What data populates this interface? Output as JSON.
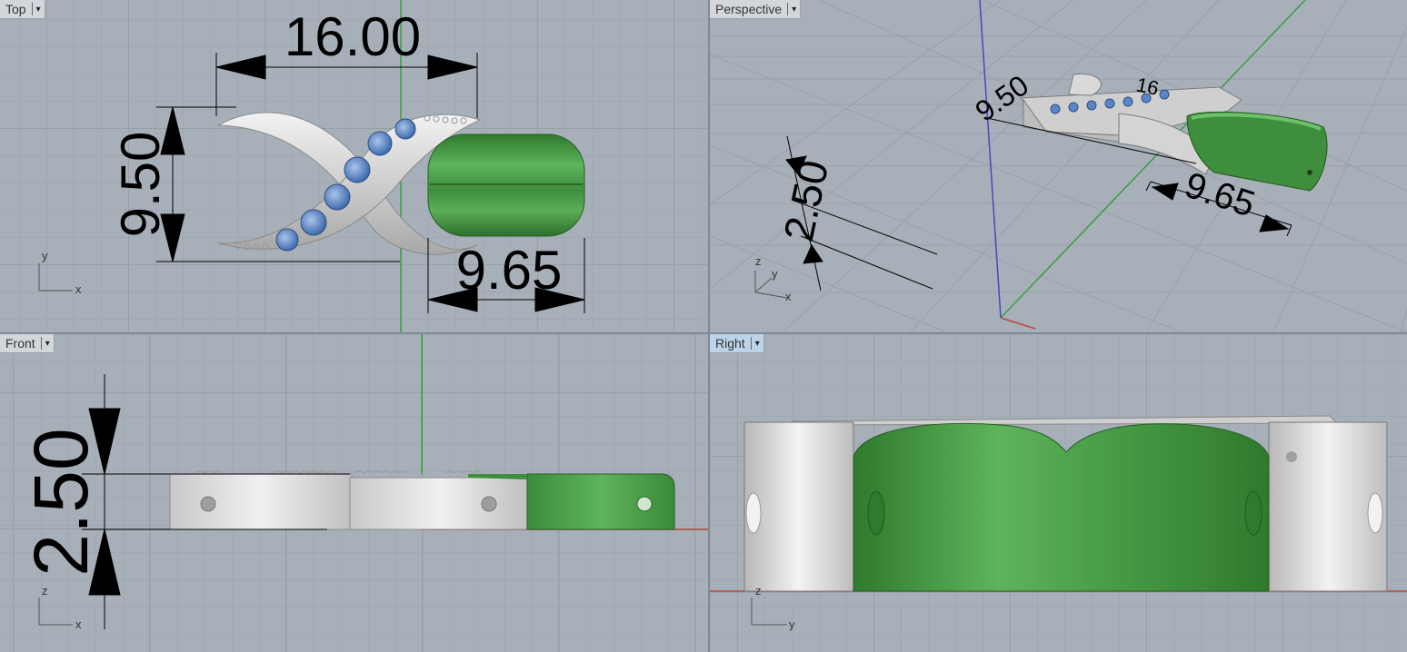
{
  "viewports": {
    "top": {
      "label": "Top",
      "dims": {
        "width": "16.00",
        "height": "9.50",
        "bead": "9.65"
      },
      "axes": {
        "v": "y",
        "h": "x"
      }
    },
    "perspective": {
      "label": "Perspective",
      "dims": {
        "thickness": "2.50",
        "height": "9.50",
        "width": "16",
        "bead": "9.65"
      },
      "axes": {
        "z": "z",
        "y": "y",
        "x": "x"
      }
    },
    "front": {
      "label": "Front",
      "dims": {
        "thickness": "2.50"
      },
      "axes": {
        "v": "z",
        "h": "x"
      }
    },
    "right": {
      "label": "Right",
      "axes": {
        "v": "z",
        "h": "y"
      }
    }
  },
  "icons": {
    "dropdown": "chevron-down-icon"
  },
  "colors": {
    "grid_bg": "#a7b0b9",
    "grid_line": "#98a1aa",
    "silver": "#d4d4d4",
    "green": "#4a9a48",
    "gem": "#5a86c8",
    "axis_x": "#b5473f",
    "axis_y": "#3c9c44",
    "axis_z": "#4747b8",
    "active_tab": "#bcd3ea"
  }
}
